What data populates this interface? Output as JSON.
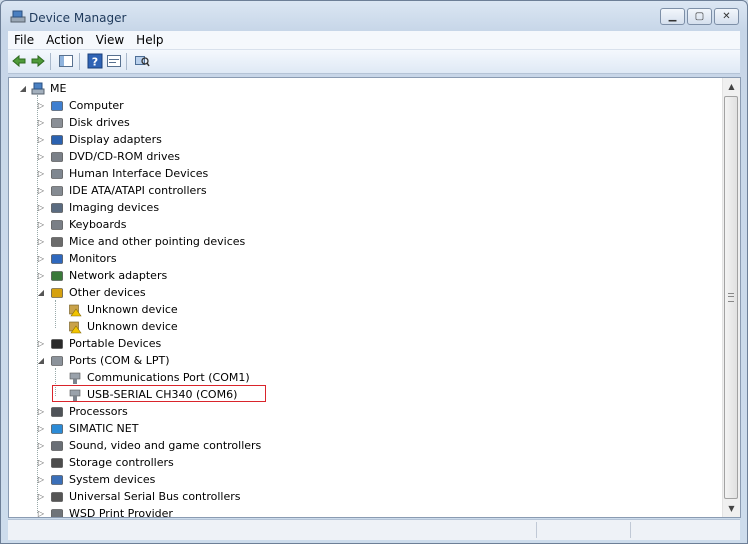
{
  "window": {
    "title": "Device Manager"
  },
  "menu": [
    "File",
    "Action",
    "View",
    "Help"
  ],
  "toolbar": [
    "back-icon",
    "forward-icon",
    "show-hide-console-tree-icon",
    "help-icon",
    "properties-icon",
    "scan-hardware-icon"
  ],
  "tree": {
    "root": "ME",
    "items": [
      {
        "label": "Computer",
        "icon": "computer-icon",
        "state": "collapsed"
      },
      {
        "label": "Disk drives",
        "icon": "disk-icon",
        "state": "collapsed"
      },
      {
        "label": "Display adapters",
        "icon": "display-icon",
        "state": "collapsed"
      },
      {
        "label": "DVD/CD-ROM drives",
        "icon": "dvd-icon",
        "state": "collapsed"
      },
      {
        "label": "Human Interface Devices",
        "icon": "hid-icon",
        "state": "collapsed"
      },
      {
        "label": "IDE ATA/ATAPI controllers",
        "icon": "ide-icon",
        "state": "collapsed"
      },
      {
        "label": "Imaging devices",
        "icon": "camera-icon",
        "state": "collapsed"
      },
      {
        "label": "Keyboards",
        "icon": "keyboard-icon",
        "state": "collapsed"
      },
      {
        "label": "Mice and other pointing devices",
        "icon": "mouse-icon",
        "state": "collapsed"
      },
      {
        "label": "Monitors",
        "icon": "monitor-icon",
        "state": "collapsed"
      },
      {
        "label": "Network adapters",
        "icon": "network-icon",
        "state": "collapsed"
      },
      {
        "label": "Other devices",
        "icon": "other-devices-icon",
        "state": "expanded",
        "children": [
          "Unknown device",
          "Unknown device"
        ]
      },
      {
        "label": "Portable Devices",
        "icon": "portable-icon",
        "state": "collapsed"
      },
      {
        "label": "Ports (COM & LPT)",
        "icon": "port-icon",
        "state": "expanded",
        "children": [
          "Communications Port (COM1)",
          "USB-SERIAL CH340 (COM6)"
        ]
      },
      {
        "label": "Processors",
        "icon": "processor-icon",
        "state": "collapsed"
      },
      {
        "label": "SIMATIC NET",
        "icon": "simatic-icon",
        "state": "collapsed"
      },
      {
        "label": "Sound, video and game controllers",
        "icon": "sound-icon",
        "state": "collapsed"
      },
      {
        "label": "Storage controllers",
        "icon": "storage-icon",
        "state": "collapsed"
      },
      {
        "label": "System devices",
        "icon": "system-icon",
        "state": "collapsed"
      },
      {
        "label": "Universal Serial Bus controllers",
        "icon": "usb-icon",
        "state": "collapsed"
      },
      {
        "label": "WSD Print Provider",
        "icon": "printer-icon",
        "state": "collapsed"
      }
    ]
  },
  "highlighted_item": "USB-SERIAL CH340 (COM6)",
  "colors": {
    "highlight_border": "#d9242b",
    "window_frame": "#6d7f97",
    "warning": "#e6b800"
  }
}
